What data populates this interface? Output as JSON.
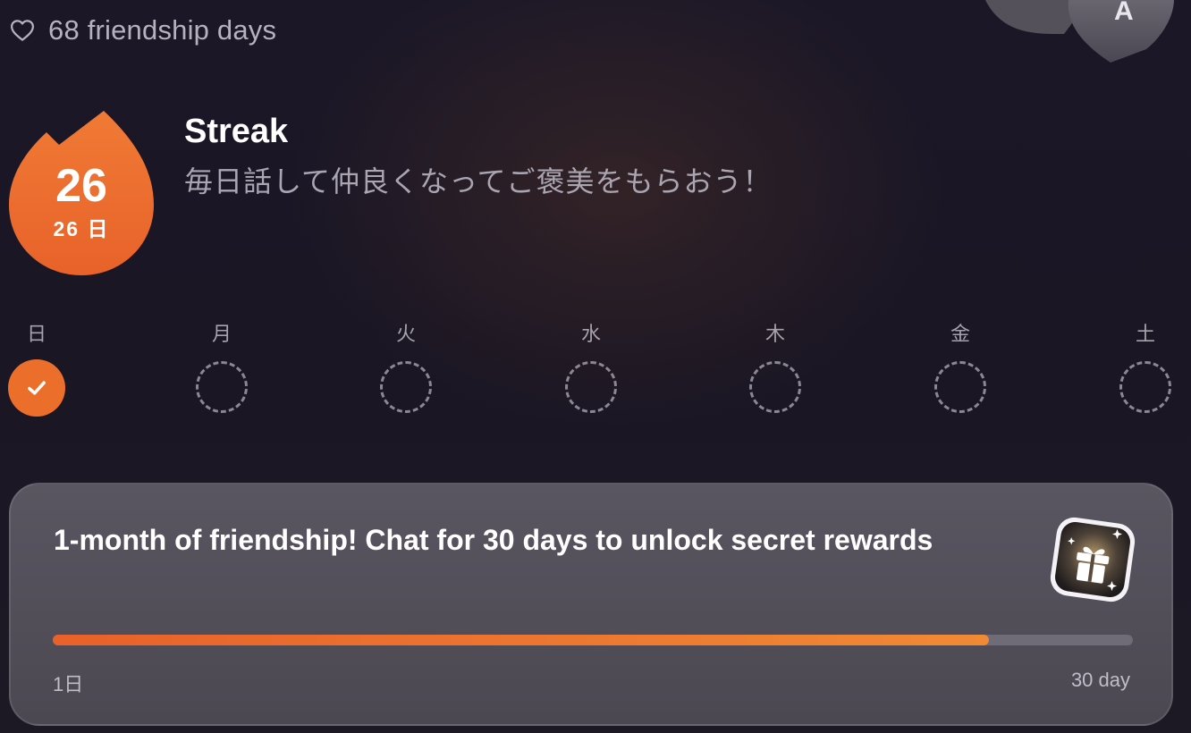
{
  "friendship": {
    "text": "68 friendship days",
    "icon": "heart-outline-icon"
  },
  "streak": {
    "count": "26",
    "days_label": "26 日",
    "title": "Streak",
    "subtitle": "毎日話して仲良くなってご褒美をもらおう！",
    "accent_color": "#ec6e2b"
  },
  "week": {
    "days": [
      {
        "label": "日",
        "done": true
      },
      {
        "label": "月",
        "done": false
      },
      {
        "label": "火",
        "done": false
      },
      {
        "label": "水",
        "done": false
      },
      {
        "label": "木",
        "done": false
      },
      {
        "label": "金",
        "done": false
      },
      {
        "label": "土",
        "done": false
      }
    ]
  },
  "reward": {
    "title": "1-month of friendship! Chat for 30 days to unlock secret rewards",
    "progress": 0.867,
    "start_label": "1日",
    "end_label": "30 day",
    "icon": "gift-icon"
  },
  "top_badge_letter": "A"
}
